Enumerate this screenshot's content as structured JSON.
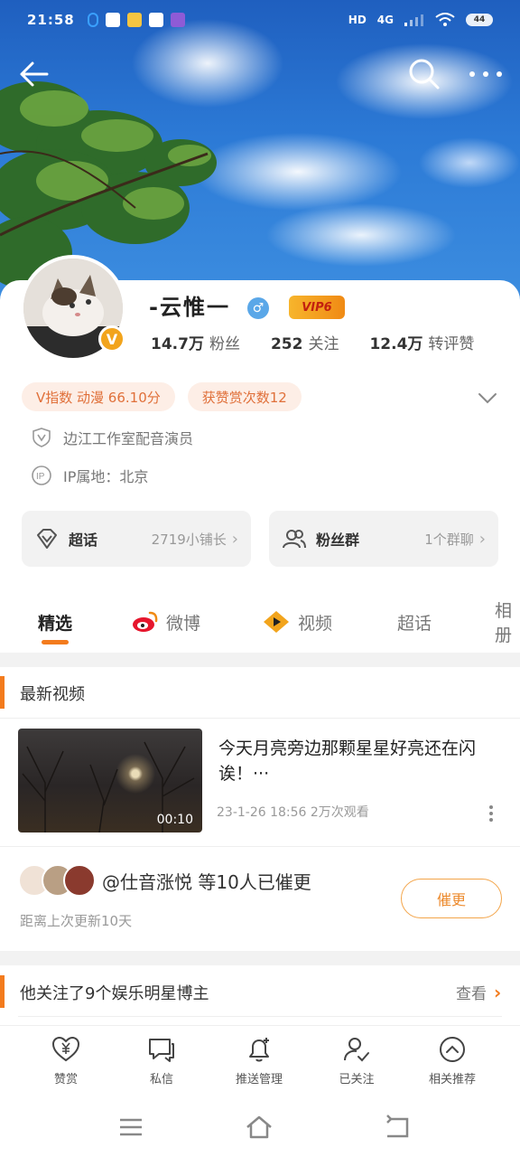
{
  "status_bar": {
    "time": "21:58",
    "network": "4G",
    "hd": "HD",
    "battery": "44"
  },
  "profile": {
    "name": "-云惟一",
    "gender_symbol": "♂",
    "vip_label": "VIP6",
    "verified_badge": "V",
    "stats": [
      {
        "value": "14.7万",
        "label": "粉丝"
      },
      {
        "value": "252",
        "label": "关注"
      },
      {
        "value": "12.4万",
        "label": "转评赞"
      }
    ],
    "tags": [
      "V指数 动漫 66.10分",
      "获赞赏次数12"
    ],
    "occupation": "边江工作室配音演员",
    "ip_location": "IP属地：北京"
  },
  "pills": [
    {
      "icon": "diamond-icon",
      "title": "超话",
      "sub": "2719小铺长"
    },
    {
      "icon": "group-icon",
      "title": "粉丝群",
      "sub": "1个群聊"
    }
  ],
  "tabs": [
    "精选",
    "微博",
    "视频",
    "超话",
    "相册"
  ],
  "latest_videos": {
    "section_title": "最新视频",
    "video": {
      "duration": "00:10",
      "title": "今天月亮旁边那颗星星好亮还在闪诶！···",
      "meta": "23-1-26 18:56  2万次观看"
    }
  },
  "urge": {
    "text": "@仕音涨悦 等10人已催更",
    "sub": "距离上次更新10天",
    "button": "催更"
  },
  "follows": {
    "text": "他关注了9个娱乐明星博主",
    "view_all": "查看"
  },
  "actions": [
    "赞赏",
    "私信",
    "推送管理",
    "已关注",
    "相关推荐"
  ],
  "colors": {
    "accent": "#f37b1d",
    "vip": "#f2a41c",
    "tag_bg": "#fdeee6",
    "tag_text": "#e0703a"
  }
}
